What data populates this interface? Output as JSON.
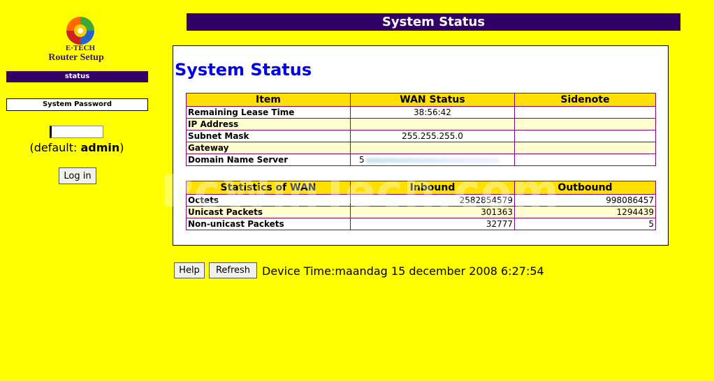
{
  "sidebar": {
    "logo": {
      "brand": "E·TECH",
      "subtitle": "Router Setup"
    },
    "status_label": "status",
    "password_label": "System Password",
    "password_value": "",
    "default_hint_prefix": "(default: ",
    "default_hint_value": "admin",
    "default_hint_suffix": ")",
    "login_label": "Log in"
  },
  "header": {
    "title": "System Status"
  },
  "main": {
    "title": "System Status",
    "wan_table": {
      "headers": [
        "Item",
        "WAN Status",
        "Sidenote"
      ],
      "rows": [
        {
          "item": "Remaining Lease Time",
          "status": "38:56:42",
          "note": ""
        },
        {
          "item": "IP Address",
          "status": "",
          "note": ""
        },
        {
          "item": "Subnet Mask",
          "status": "255.255.255.0",
          "note": ""
        },
        {
          "item": "Gateway",
          "status": "",
          "note": ""
        },
        {
          "item": "Domain Name Server",
          "status": "5",
          "note": ""
        }
      ]
    },
    "stats_table": {
      "headers": [
        "Statistics of WAN",
        "Inbound",
        "Outbound"
      ],
      "rows": [
        {
          "item": "Octets",
          "inbound": "2582854579",
          "outbound": "998086457"
        },
        {
          "item": "Unicast Packets",
          "inbound": "301363",
          "outbound": "1294439"
        },
        {
          "item": "Non-unicast Packets",
          "inbound": "32777",
          "outbound": "5"
        }
      ]
    }
  },
  "footer": {
    "help_label": "Help",
    "refresh_label": "Refresh",
    "device_time": "Device Time:maandag 15 december 2008 6:27:54"
  },
  "watermark": "PcWinTech.com",
  "colors": {
    "background": "#ffff00",
    "accent": "#330066",
    "table_header": "#ffe000",
    "title_blue": "#0000ee"
  }
}
